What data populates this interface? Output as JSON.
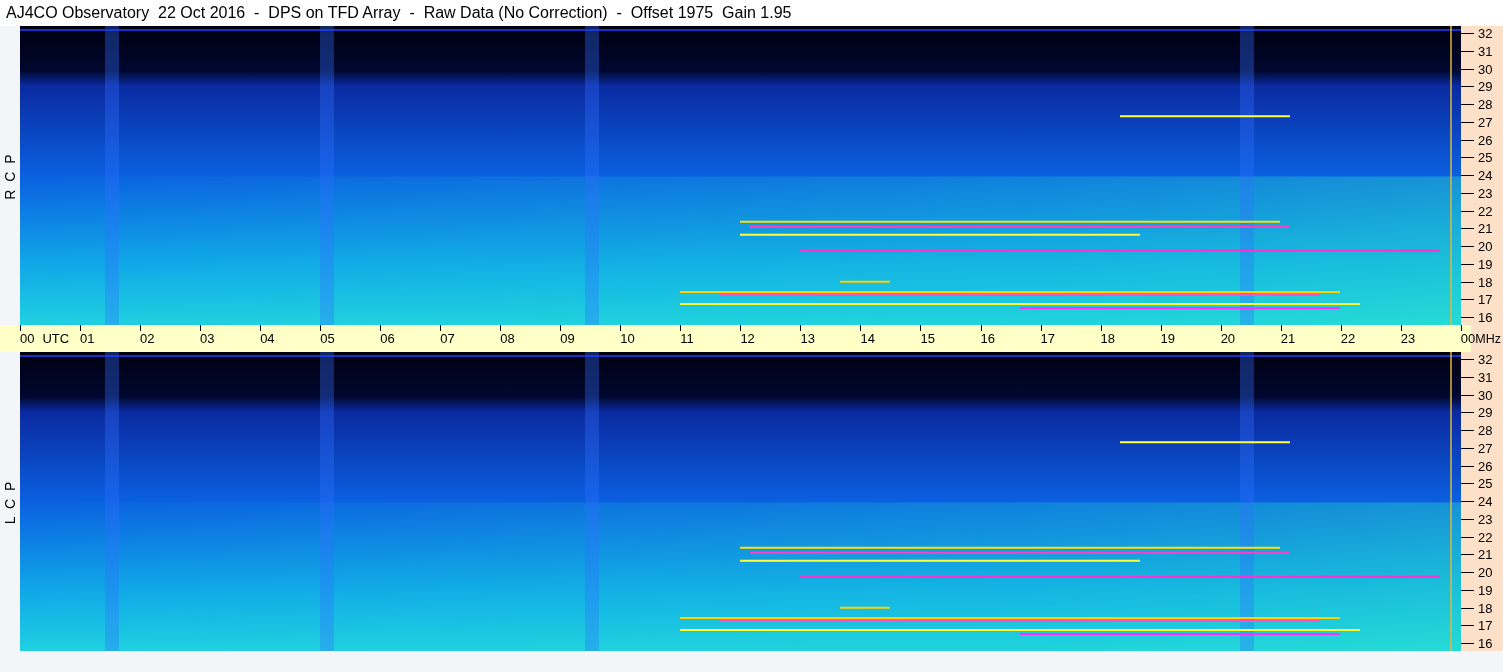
{
  "title": "AJ4CO Observatory  22 Oct 2016  -  DPS on TFD Array  -  Raw Data (No Correction)  -  Offset 1975  Gain 1.95",
  "panels": [
    {
      "label": "R C P",
      "freq_labels": [
        "32",
        "31",
        "30",
        "29",
        "28",
        "27",
        "26",
        "25",
        "24",
        "23",
        "22",
        "21",
        "20",
        "19",
        "18",
        "17",
        "16"
      ]
    },
    {
      "label": "L C P",
      "freq_labels": [
        "32",
        "31",
        "30",
        "29",
        "28",
        "27",
        "26",
        "25",
        "24",
        "23",
        "22",
        "21",
        "20",
        "19",
        "18",
        "17",
        "16"
      ]
    }
  ],
  "time_axis": {
    "labels": [
      "00",
      "01",
      "02",
      "03",
      "04",
      "05",
      "06",
      "07",
      "08",
      "09",
      "10",
      "11",
      "12",
      "13",
      "14",
      "15",
      "16",
      "17",
      "18",
      "19",
      "20",
      "21",
      "22",
      "23",
      "00"
    ],
    "zone": "UTC",
    "unit": "MHz"
  }
}
